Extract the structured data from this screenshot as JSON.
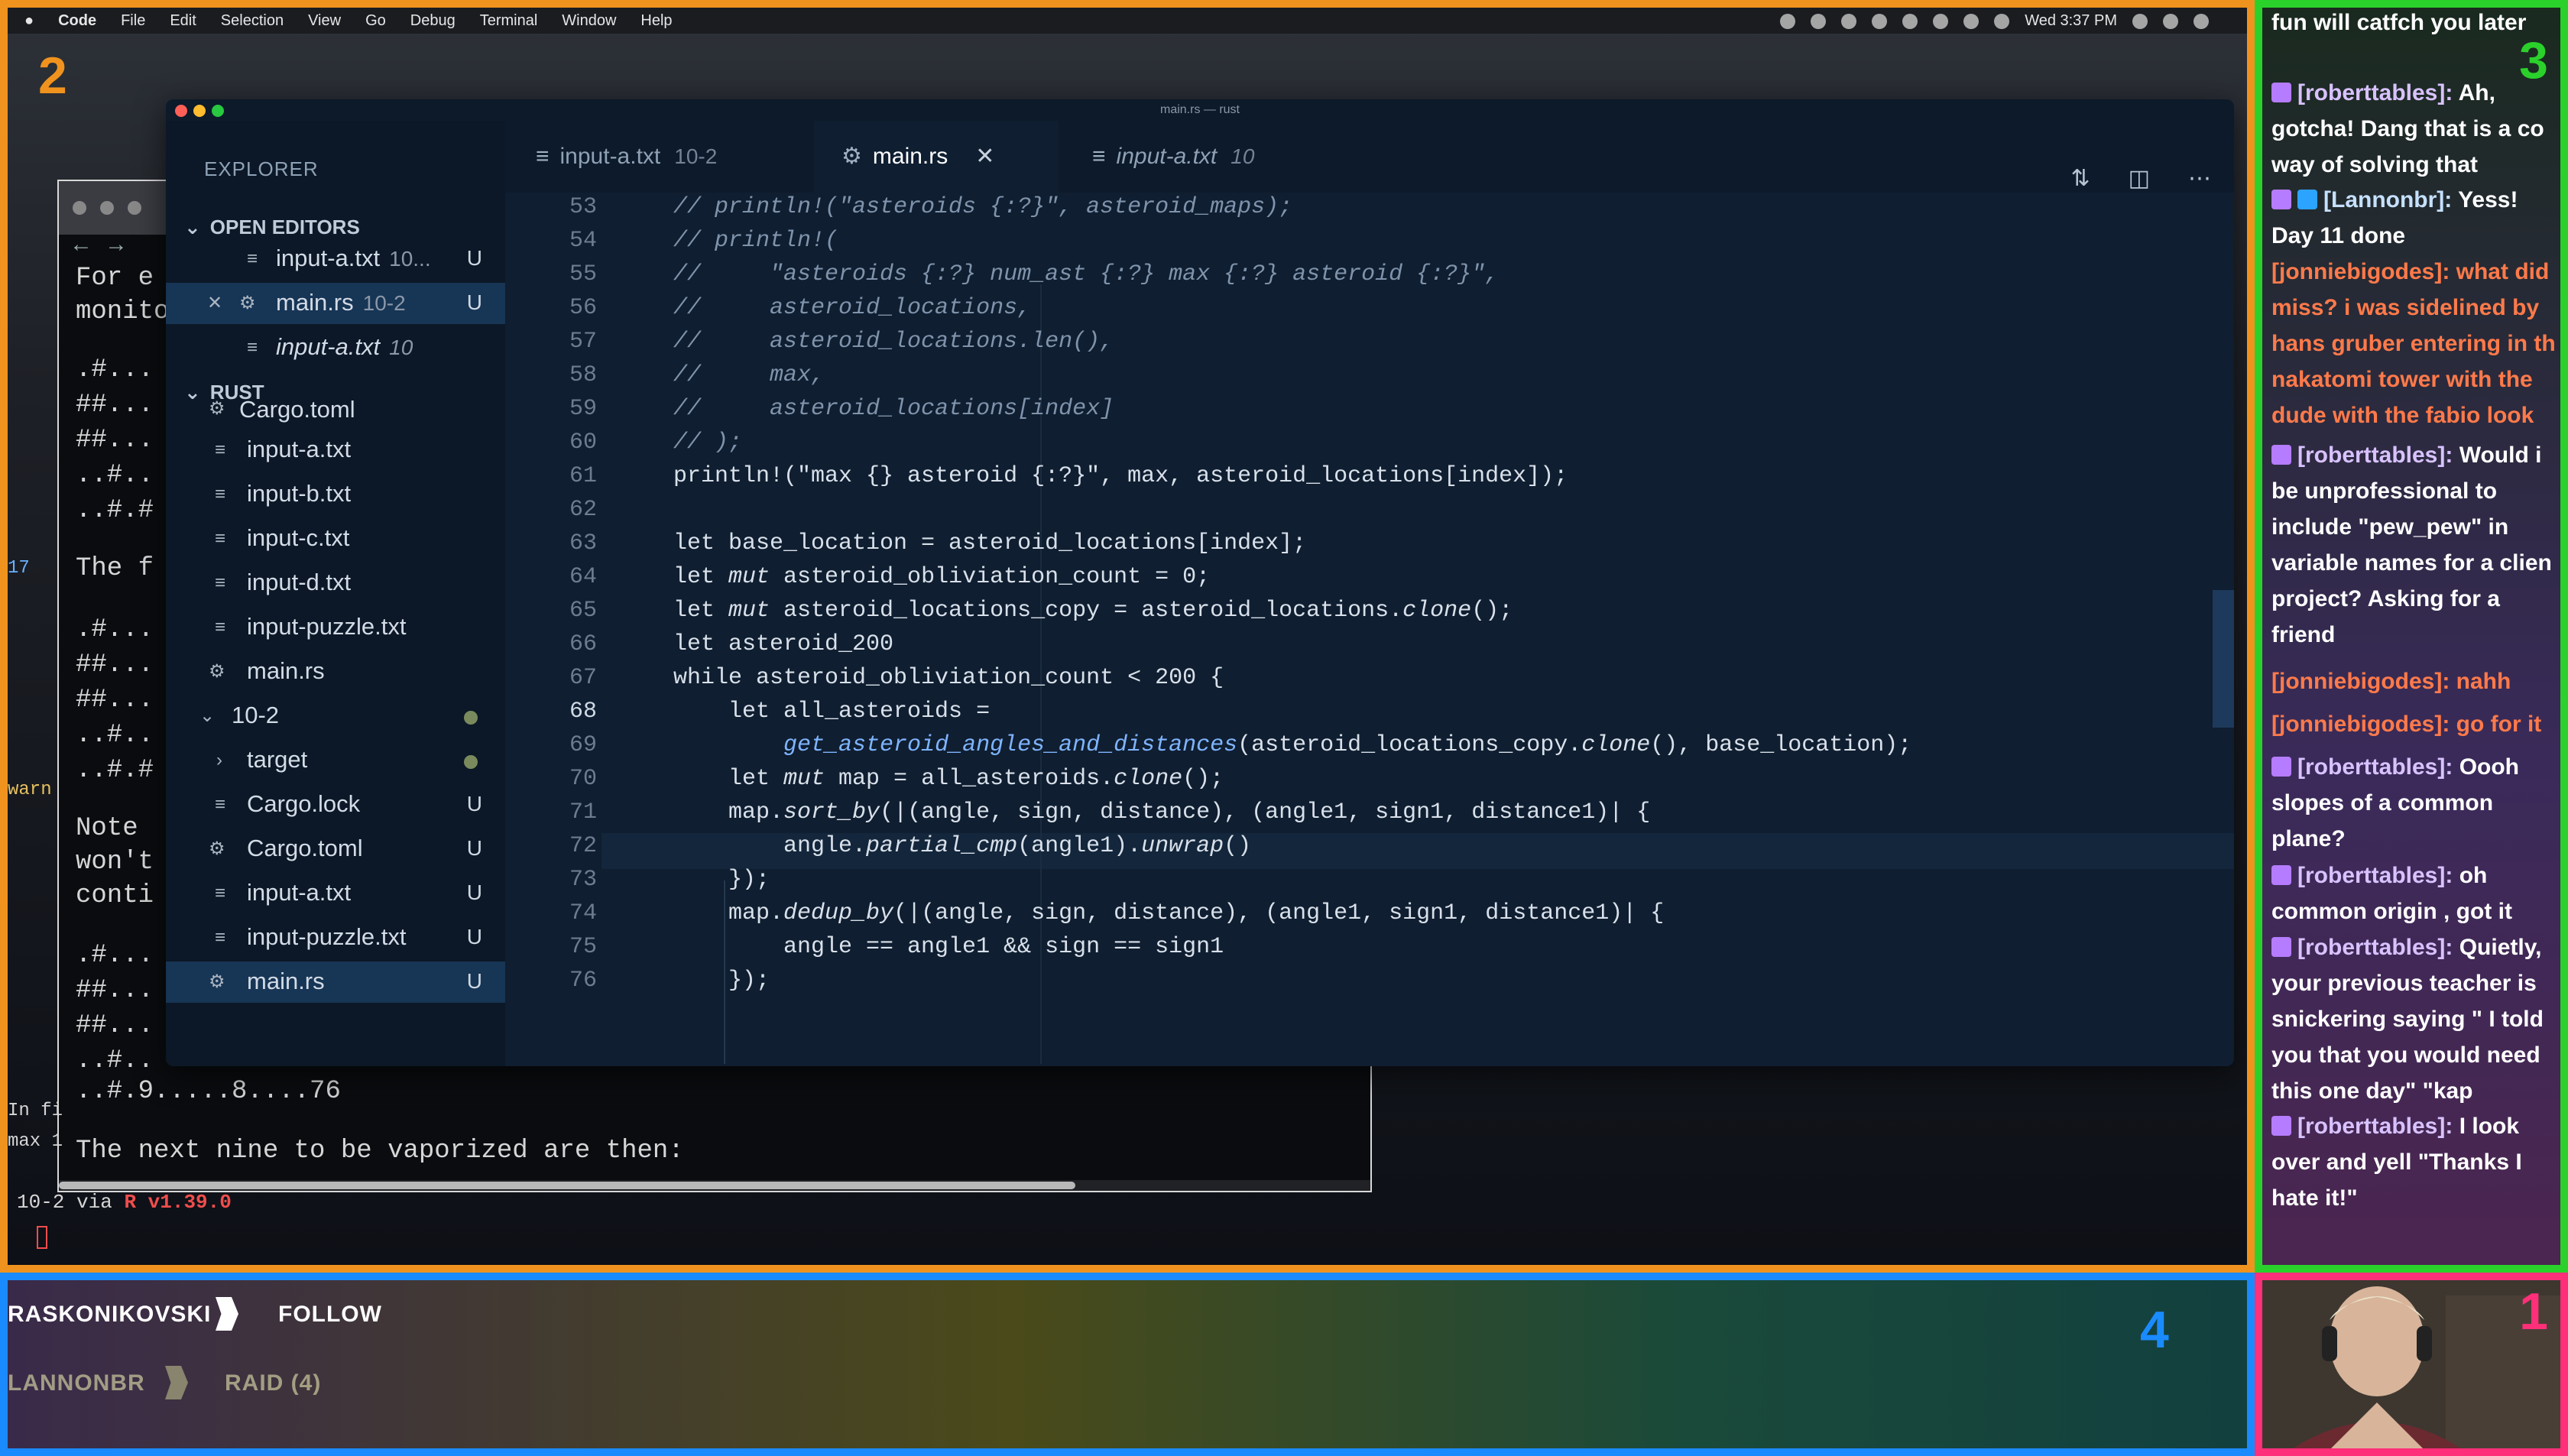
{
  "menubar": {
    "apple": "",
    "app": "Code",
    "items": [
      "File",
      "Edit",
      "Selection",
      "View",
      "Go",
      "Debug",
      "Terminal",
      "Window",
      "Help"
    ],
    "clock": "Wed 3:37 PM"
  },
  "terminal": {
    "lines": [
      "For e",
      "monito",
      ".#...",
      "##...",
      "##...",
      "..#..",
      "..#.#",
      "The f",
      ".#...",
      "##...",
      "##...",
      "..#..",
      "..#.#",
      "Note",
      "won't",
      "conti",
      ".#...",
      "##...",
      "##...",
      "..#..",
      "..#.9.....8....76",
      "The next nine to be vaporized are then:"
    ],
    "gutter_a": "17",
    "gutter_b": "warn",
    "gutter_c": "In fi",
    "gutter_d": "max 1",
    "prompt_dir": "10-2",
    "prompt_via": " via ",
    "prompt_r": "R",
    "prompt_ver": " v1.39.0"
  },
  "vscode": {
    "window_title": "main.rs — rust",
    "explorer_title": "EXPLORER",
    "open_editors_title": "OPEN EDITORS",
    "open_editors": [
      {
        "name": "input-a.txt",
        "desc": "10...",
        "status": "U",
        "italic": false
      },
      {
        "name": "main.rs",
        "desc": "10-2",
        "status": "U",
        "italic": false
      },
      {
        "name": "input-a.txt",
        "desc": "10",
        "status": "",
        "italic": true
      }
    ],
    "rust_title": "RUST",
    "tree": [
      {
        "name": "Cargo.toml",
        "status": ""
      },
      {
        "name": "input-a.txt",
        "status": ""
      },
      {
        "name": "input-b.txt",
        "status": ""
      },
      {
        "name": "input-c.txt",
        "status": ""
      },
      {
        "name": "input-d.txt",
        "status": ""
      },
      {
        "name": "input-puzzle.txt",
        "status": ""
      },
      {
        "name": "main.rs",
        "status": ""
      },
      {
        "name": "10-2",
        "status": ""
      },
      {
        "name": "target",
        "status": ""
      },
      {
        "name": "Cargo.lock",
        "status": "U"
      },
      {
        "name": "Cargo.toml",
        "status": "U"
      },
      {
        "name": "input-a.txt",
        "status": "U"
      },
      {
        "name": "input-puzzle.txt",
        "status": "U"
      },
      {
        "name": "main.rs",
        "status": "U"
      }
    ],
    "tabs": [
      {
        "name": "input-a.txt",
        "sub": "10-2"
      },
      {
        "name": "main.rs",
        "sub": ""
      },
      {
        "name": "input-a.txt",
        "sub": "10"
      }
    ],
    "close_glyph": "✕",
    "line_numbers": [
      "53",
      "54",
      "55",
      "56",
      "57",
      "58",
      "59",
      "60",
      "61",
      "62",
      "63",
      "64",
      "65",
      "66",
      "67",
      "68",
      "69",
      "70",
      "71",
      "72",
      "73",
      "74",
      "75",
      "76"
    ],
    "code": {
      "l53": "// println!(\"asteroids {:?}\", asteroid_maps);",
      "l54": "// println!(",
      "l55": "//     \"asteroids {:?} num_ast {:?} max {:?} asteroid {:?}\",",
      "l56": "//     asteroid_locations,",
      "l57": "//     asteroid_locations.len(),",
      "l58": "//     max,",
      "l59": "//     asteroid_locations[index]",
      "l60": "// );",
      "l61": "println!(\"max {} asteroid {:?}\", max, asteroid_locations[index]);",
      "l62": "",
      "l63": "let base_location = asteroid_locations[index];",
      "l64a": "let ",
      "l64b": "mut",
      "l64c": " asteroid_obliviation_count = 0;",
      "l65a": "let ",
      "l65b": "mut",
      "l65c": " asteroid_locations_copy = asteroid_locations.",
      "l65d": "clone",
      "l65e": "();",
      "l66": "let asteroid_200",
      "l67": "while asteroid_obliviation_count < 200 {",
      "l68": "    let all_asteroids =",
      "l69a": "        ",
      "l69b": "get_asteroid_angles_and_distances",
      "l69c": "(asteroid_locations_copy.",
      "l69d": "clone",
      "l69e": "(), base_location);",
      "l70a": "    let ",
      "l70b": "mut",
      "l70c": " map = all_asteroids.",
      "l70d": "clone",
      "l70e": "();",
      "l71a": "    map.",
      "l71b": "sort_by",
      "l71c": "(|(angle, sign, distance), (angle1, sign1, distance1)| {",
      "l72a": "        angle.",
      "l72b": "partial_cmp",
      "l72c": "(angle1).",
      "l72d": "unwrap",
      "l72e": "()",
      "l73": "    });",
      "l74a": "    map.",
      "l74b": "dedup_by",
      "l74c": "(|(angle, sign, distance), (angle1, sign1, distance1)| {",
      "l75": "        angle == angle1 && sign == sign1",
      "l76": "    });"
    }
  },
  "chat": {
    "messages": [
      {
        "user": "",
        "text": "fun will catfch you later",
        "color": "white"
      },
      {
        "user": "[roberttables]:",
        "text": " Ah, gotcha! Dang that is a co way of solving that",
        "color": "u1"
      },
      {
        "user": "[Lannonbr]:",
        "text": " Yess! Day 11 done",
        "color": "u3"
      },
      {
        "user": "[jonniebigodes]:",
        "text": " what did miss? i was sidelined by hans gruber entering in th nakatomi tower with the dude with the fabio look",
        "color": "u2"
      },
      {
        "user": "[roberttables]:",
        "text": " Would i be unprofessional to include \"pew_pew\" in variable names for a clien project? Asking for a friend",
        "color": "u1"
      },
      {
        "user": "[jonniebigodes]:",
        "text": " nahh",
        "color": "u2"
      },
      {
        "user": "[jonniebigodes]:",
        "text": " go for it",
        "color": "u2"
      },
      {
        "user": "[roberttables]:",
        "text": " Oooh slopes of a common plane?",
        "color": "u1"
      },
      {
        "user": "[roberttables]:",
        "text": " oh common origin , got it",
        "color": "u1"
      },
      {
        "user": "[roberttables]:",
        "text": " Quietly, your previous teacher is snickering saying \" I told you that you would need this one day\" \"kap",
        "color": "u1"
      },
      {
        "user": "[roberttables]:",
        "text": " I look over and yell \"Thanks I hate it!\"",
        "color": "u1"
      }
    ]
  },
  "alerts": {
    "follow_user": "RASKONIKOVSKI",
    "follow_label": "FOLLOW",
    "raid_user": "LANNONBR",
    "raid_label": "RAID (4)"
  },
  "region_numbers": {
    "one": "1",
    "two": "2",
    "three": "3",
    "four": "4"
  },
  "colors": {
    "frame_desktop": "#f0931e",
    "frame_chat": "#2bd12b",
    "frame_alerts": "#1a8bff",
    "frame_camera": "#ff2f7a"
  }
}
